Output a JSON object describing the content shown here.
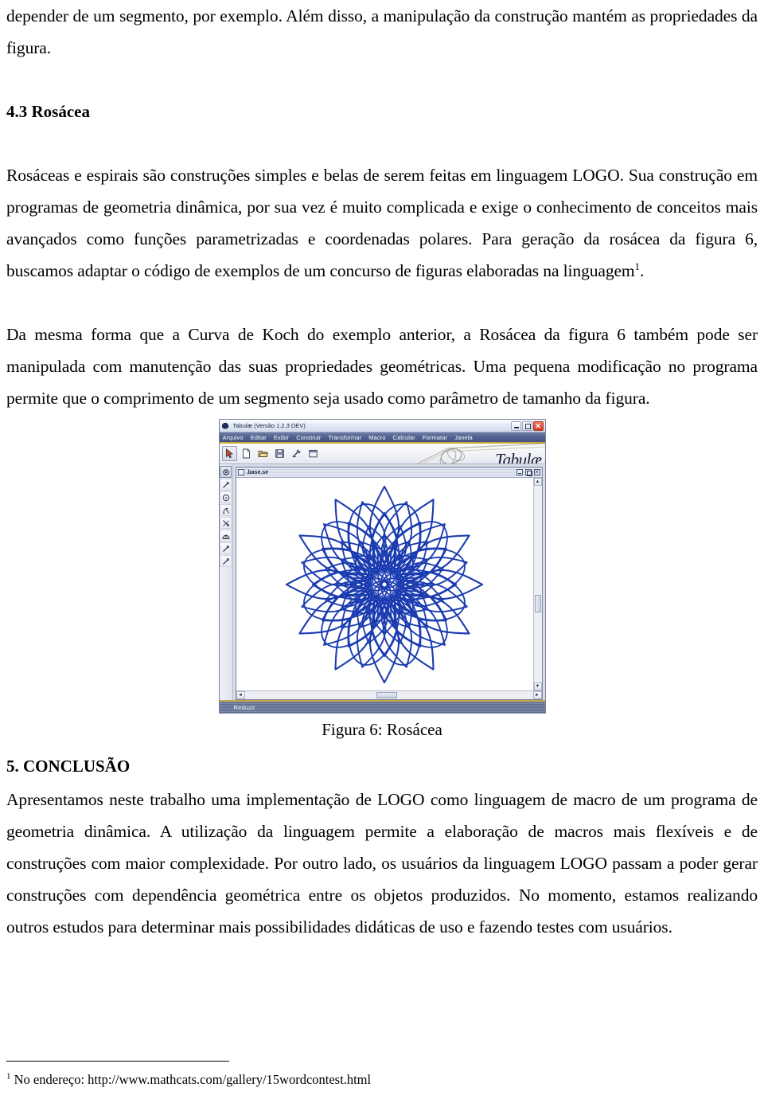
{
  "document": {
    "paragraphs": {
      "p_intro": "depender de um segmento, por exemplo. Além disso, a manipulação da construção mantém as propriedades da figura.",
      "p_rosacea_1": "Rosáceas e espirais são construções simples e belas de serem feitas em linguagem LOGO. Sua construção em programas de geometria dinâmica, por sua vez é muito complicada e exige o conhecimento de conceitos mais avançados como funções parametrizadas e coordenadas polares. Para geração da rosácea da figura 6, buscamos adaptar o código de exemplos de um concurso de figuras elaboradas na linguagem",
      "p_rosacea_1_tail": ".",
      "p_rosacea_2": "Da mesma forma que a Curva de Koch do exemplo anterior, a Rosácea da figura 6 também pode ser manipulada com manutenção das suas propriedades geométricas. Uma pequena modificação no programa permite que o comprimento de um segmento seja usado como parâmetro de tamanho da figura.",
      "p_conclusion": "Apresentamos neste trabalho uma implementação de LOGO como linguagem de macro de um programa de geometria dinâmica. A utilização da linguagem permite a elaboração de macros mais flexíveis e de construções com maior complexidade. Por outro lado, os usuários da linguagem LOGO passam a poder gerar construções com dependência geométrica entre os objetos produzidos. No momento, estamos realizando outros estudos para determinar mais possibilidades didáticas de uso e fazendo testes com usuários."
    },
    "headings": {
      "section_4_3": "4.3 Rosácea",
      "section_5": "5. CONCLUSÃO"
    },
    "figure": {
      "caption": "Figura 6: Rosácea"
    },
    "footnote": {
      "marker": "1",
      "text": "No endereço: http://www.mathcats.com/gallery/15wordcontest.html"
    },
    "footnote_ref_marker": "1"
  },
  "screenshot": {
    "window": {
      "title": "Tabulæ (Versão 1.2.3 DEV)",
      "app_icon": "app-icon",
      "controls": {
        "minimize": "–",
        "maximize": "□",
        "close": "✕"
      }
    },
    "menubar": {
      "items": [
        {
          "label": "Arquivo",
          "mnemonic": "A"
        },
        {
          "label": "Editar",
          "mnemonic": "E"
        },
        {
          "label": "Exibir",
          "mnemonic": "x"
        },
        {
          "label": "Construir",
          "mnemonic": "C"
        },
        {
          "label": "Transformar",
          "mnemonic": "T"
        },
        {
          "label": "Macro",
          "mnemonic": "M"
        },
        {
          "label": "Calcular",
          "mnemonic": "l"
        },
        {
          "label": "Formatar",
          "mnemonic": "F"
        },
        {
          "label": "Janela",
          "mnemonic": "J"
        }
      ]
    },
    "toolbar": {
      "buttons": [
        {
          "name": "select-arrow-tool",
          "icon": "cursor-arrow-icon",
          "active": true
        },
        {
          "name": "new-file-button",
          "icon": "new-document-icon",
          "active": false
        },
        {
          "name": "open-file-button",
          "icon": "open-folder-icon",
          "active": false
        },
        {
          "name": "save-file-button",
          "icon": "floppy-save-icon",
          "active": false
        },
        {
          "name": "tool-button-5",
          "icon": "pen-curve-icon",
          "active": false
        },
        {
          "name": "tool-button-6",
          "icon": "window-frame-icon",
          "active": false
        }
      ]
    },
    "logo": {
      "text": "Tabulæ"
    },
    "tool_palette": {
      "tools": [
        {
          "name": "point-tool",
          "icon": "point-icon",
          "selected": true
        },
        {
          "name": "segment-tool",
          "icon": "pencil-line-icon",
          "selected": false
        },
        {
          "name": "circle-tool",
          "icon": "circle-icon",
          "selected": false
        },
        {
          "name": "compass-tool",
          "icon": "compass-icon",
          "selected": false
        },
        {
          "name": "vector-tool",
          "icon": "vector-arrow-icon",
          "selected": false
        },
        {
          "name": "arc-tool",
          "icon": "arc-shape-icon",
          "selected": false
        },
        {
          "name": "line-tool",
          "icon": "line-icon",
          "selected": false
        },
        {
          "name": "ray-tool",
          "icon": "ray-icon",
          "selected": false
        }
      ]
    },
    "mdi_child": {
      "title": ".base.se",
      "controls": {
        "minimize": "–",
        "maximize": "□",
        "close": "✕"
      }
    },
    "scrollbars": {
      "up_arrow": "▲",
      "down_arrow": "▼",
      "left_arrow": "◄",
      "right_arrow": "►"
    },
    "statusbar": {
      "text": "Reduzir"
    },
    "drawing": {
      "name": "rosacea-figure",
      "line_color": "#1b3cb0",
      "background": "#ffffff",
      "symmetry": 12,
      "description": "Rosácea: 12-fold symmetric rosette of overlapping lens/petal curves drawn in LOGO"
    }
  }
}
